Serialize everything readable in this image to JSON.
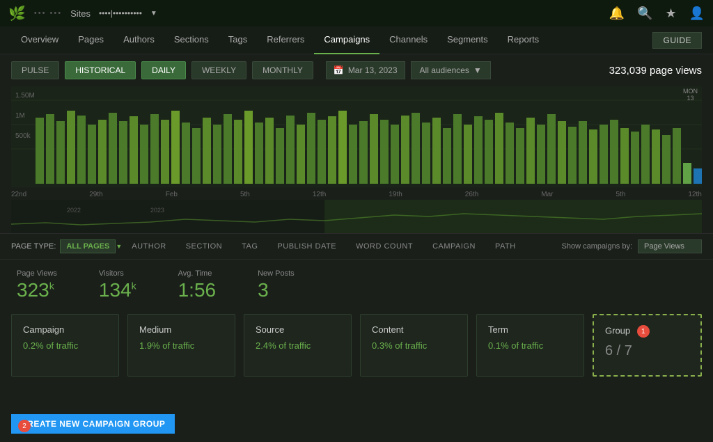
{
  "topbar": {
    "logo": "🌿",
    "site_dots": "••• •••",
    "sites_label": "Sites",
    "site_name": "••••|••••••••••",
    "notification_icon": "🔔",
    "search_icon": "🔍",
    "star_icon": "★",
    "user_icon": "👤"
  },
  "nav": {
    "tabs": [
      "Overview",
      "Pages",
      "Authors",
      "Sections",
      "Tags",
      "Referrers",
      "Campaigns",
      "Channels",
      "Segments",
      "Reports"
    ],
    "active": "Campaigns",
    "guide_label": "GUIDE"
  },
  "controls": {
    "pulse_label": "PULSE",
    "historical_label": "HISTORICAL",
    "daily_label": "DAILY",
    "weekly_label": "WEEKLY",
    "monthly_label": "MONTHLY",
    "date_label": "Mar 13, 2023",
    "audience_label": "All audiences",
    "page_views_label": "323,039 page views",
    "mon_label": "MON",
    "day_label": "13"
  },
  "chart": {
    "y_labels": [
      "1.50M",
      "1M",
      "500k"
    ],
    "x_labels": [
      "22nd",
      "29th",
      "Feb",
      "5th",
      "12th",
      "19th",
      "26th",
      "Mar",
      "5th",
      "12th"
    ],
    "year_labels": [
      "2022",
      "2023"
    ]
  },
  "filters": {
    "page_type_label": "PAGE TYPE:",
    "page_type_value": "ALL PAGES",
    "items": [
      "AUTHOR",
      "SECTION",
      "TAG",
      "PUBLISH DATE",
      "WORD COUNT",
      "CAMPAIGN",
      "PATH"
    ],
    "show_campaigns_label": "Show campaigns by:",
    "show_campaigns_value": "Page Views"
  },
  "metrics": [
    {
      "label": "Page Views",
      "value": "323",
      "suffix": "k"
    },
    {
      "label": "Visitors",
      "value": "134",
      "suffix": "k"
    },
    {
      "label": "Avg. Time",
      "value": "1:56",
      "suffix": ""
    },
    {
      "label": "New Posts",
      "value": "3",
      "suffix": ""
    }
  ],
  "cards": [
    {
      "title": "Campaign",
      "stat": "0.2% of traffic",
      "fraction": ""
    },
    {
      "title": "Medium",
      "stat": "1.9% of traffic",
      "fraction": ""
    },
    {
      "title": "Source",
      "stat": "2.4% of traffic",
      "fraction": ""
    },
    {
      "title": "Content",
      "stat": "0.3% of traffic",
      "fraction": ""
    },
    {
      "title": "Term",
      "stat": "0.1% of traffic",
      "fraction": ""
    },
    {
      "title": "Group",
      "stat": "6 / 7",
      "fraction": "",
      "highlighted": true,
      "badge": "1"
    }
  ],
  "bottom": {
    "create_label": "CREATE NEW CAMPAIGN GROUP",
    "badge": "2"
  }
}
